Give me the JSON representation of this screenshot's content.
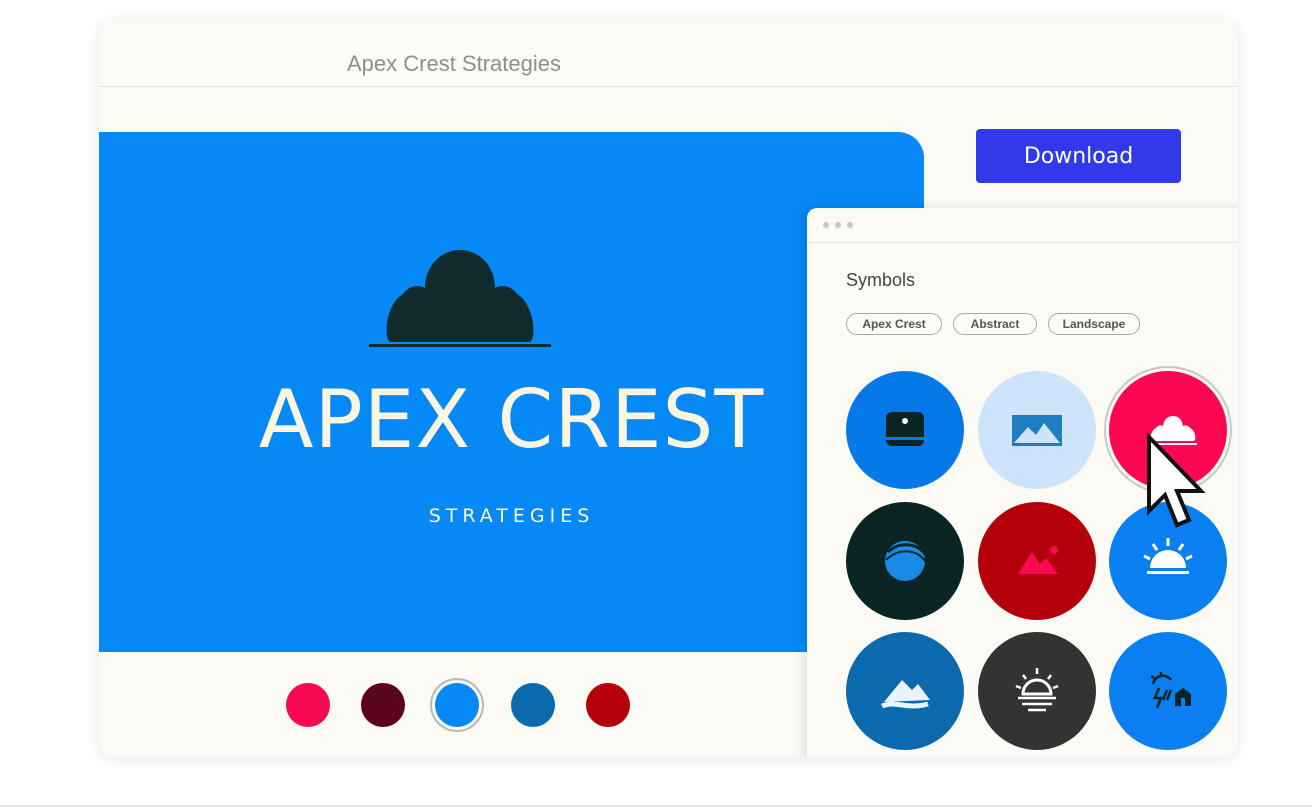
{
  "window": {
    "title": "Apex Crest Strategies"
  },
  "preview": {
    "background": "#0688f5",
    "logo_icon": "cloud-on-horizon-icon",
    "logo_color": "#0f2b2b",
    "text_color": "#fbf6e4",
    "brand_name": "APEX CREST",
    "brand_sub": "STRATEGIES"
  },
  "palette": [
    {
      "name": "swatch-crimson",
      "color": "#f5094f",
      "selected": false
    },
    {
      "name": "swatch-maroon",
      "color": "#5b051c",
      "selected": false
    },
    {
      "name": "swatch-blue",
      "color": "#0688f5",
      "selected": true
    },
    {
      "name": "swatch-steel-blue",
      "color": "#0a6aad",
      "selected": false
    },
    {
      "name": "swatch-red",
      "color": "#b3000a",
      "selected": false
    }
  ],
  "download": {
    "label": "Download",
    "color": "#3239ea"
  },
  "symbols_panel": {
    "title": "Symbols",
    "filters": [
      "Apex Crest",
      "Abstract",
      "Landscape"
    ],
    "symbols": [
      {
        "icon": "cloud-square-icon",
        "bg": "#0679e8",
        "selected": false
      },
      {
        "icon": "mountain-photo-icon",
        "bg": "#cde4fb",
        "selected": false
      },
      {
        "icon": "cloud-icon",
        "bg": "#fc0852",
        "selected": true
      },
      {
        "icon": "globe-swirl-icon",
        "bg": "#0b2525",
        "selected": false
      },
      {
        "icon": "mountain-sun-icon",
        "bg": "#b3000a",
        "selected": false
      },
      {
        "icon": "sunrise-icon",
        "bg": "#0a7ff0",
        "selected": false
      },
      {
        "icon": "mountain-river-icon",
        "bg": "#0a6aad",
        "selected": false
      },
      {
        "icon": "sunset-horizon-icon",
        "bg": "#333333",
        "selected": false
      },
      {
        "icon": "storm-house-icon",
        "bg": "#0a7ff0",
        "selected": false
      }
    ]
  },
  "pointer": {
    "icon": "mouse-pointer-icon"
  }
}
